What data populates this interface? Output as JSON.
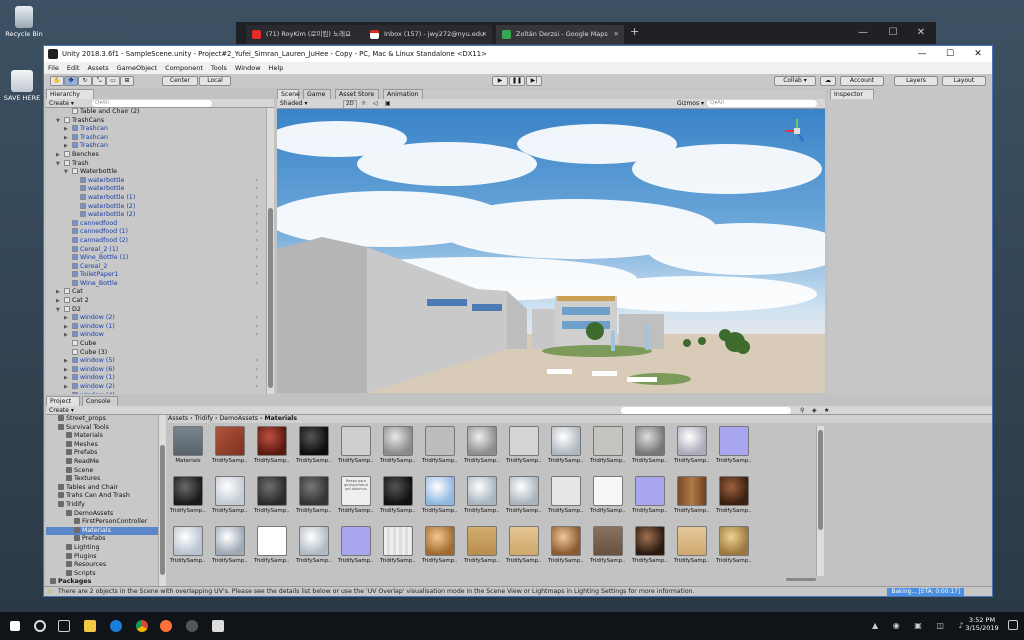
{
  "desktop": {
    "icons": [
      {
        "label": "Recycle Bin"
      },
      {
        "label": "SAVE HERE"
      }
    ]
  },
  "browser": {
    "tabs": [
      {
        "label": "(71) RoyKim (로이킴) 노래요"
      },
      {
        "label": "Inbox (157) - jwy272@nyu.edu"
      },
      {
        "label": "Zoltán Derzsi - Google Maps"
      }
    ],
    "new_tab": "+",
    "minimize": "—",
    "maximize": "☐",
    "close": "✕"
  },
  "window": {
    "title": "Unity 2018.3.6f1 - SampleScene.unity - Project#2_Yufei_Simran_Lauren_JuHee - Copy - PC, Mac & Linux Standalone <DX11>",
    "minimize": "—",
    "maximize": "☐",
    "close": "✕"
  },
  "menu": [
    "File",
    "Edit",
    "Assets",
    "GameObject",
    "Component",
    "Tools",
    "Window",
    "Help"
  ],
  "toolbar": {
    "center": "Center",
    "local": "Local",
    "collab": "Collab ▾",
    "account": "Account",
    "layers": "Layers",
    "layout": "Layout"
  },
  "hierarchy": {
    "tab": "Hierarchy",
    "create": "Create ▾",
    "search": "Q▾All",
    "rows": [
      {
        "label": "Table and Chair (2)",
        "indent": 1,
        "arrow": "",
        "blue": false
      },
      {
        "label": "TrashCans",
        "indent": 0,
        "arrow": "▼",
        "blue": false
      },
      {
        "label": "Trashcan",
        "indent": 1,
        "arrow": "▶",
        "blue": true
      },
      {
        "label": "Trashcan",
        "indent": 1,
        "arrow": "▶",
        "blue": true
      },
      {
        "label": "Trashcan",
        "indent": 1,
        "arrow": "▶",
        "blue": true
      },
      {
        "label": "Benches",
        "indent": 0,
        "arrow": "▶",
        "blue": false
      },
      {
        "label": "Trash",
        "indent": 0,
        "arrow": "▼",
        "blue": false
      },
      {
        "label": "Waterbottle",
        "indent": 1,
        "arrow": "▼",
        "blue": false
      },
      {
        "label": "waterbottle",
        "indent": 2,
        "arrow": "",
        "blue": true,
        "more": true
      },
      {
        "label": "waterbottle",
        "indent": 2,
        "arrow": "",
        "blue": true,
        "more": true
      },
      {
        "label": "waterbottle (1)",
        "indent": 2,
        "arrow": "",
        "blue": true,
        "more": true
      },
      {
        "label": "waterbottle (2)",
        "indent": 2,
        "arrow": "",
        "blue": true,
        "more": true
      },
      {
        "label": "waterbottle (2)",
        "indent": 2,
        "arrow": "",
        "blue": true,
        "more": true
      },
      {
        "label": "cannedfood",
        "indent": 1,
        "arrow": "",
        "blue": true,
        "more": true
      },
      {
        "label": "cannedfood (1)",
        "indent": 1,
        "arrow": "",
        "blue": true,
        "more": true
      },
      {
        "label": "cannedfood (2)",
        "indent": 1,
        "arrow": "",
        "blue": true,
        "more": true
      },
      {
        "label": "Cereal_2 (1)",
        "indent": 1,
        "arrow": "",
        "blue": true,
        "more": true
      },
      {
        "label": "Wine_Bottle (1)",
        "indent": 1,
        "arrow": "",
        "blue": true,
        "more": true
      },
      {
        "label": "Cereal_2",
        "indent": 1,
        "arrow": "",
        "blue": true,
        "more": true
      },
      {
        "label": "ToiletPaper1",
        "indent": 1,
        "arrow": "",
        "blue": true,
        "more": true
      },
      {
        "label": "Wine_Bottle",
        "indent": 1,
        "arrow": "",
        "blue": true,
        "more": true
      },
      {
        "label": "Cat",
        "indent": 0,
        "arrow": "▶",
        "blue": false
      },
      {
        "label": "Cat 2",
        "indent": 0,
        "arrow": "▶",
        "blue": false
      },
      {
        "label": "D2",
        "indent": 0,
        "arrow": "▼",
        "blue": false
      },
      {
        "label": "window (2)",
        "indent": 1,
        "arrow": "▶",
        "blue": true,
        "more": true
      },
      {
        "label": "window (1)",
        "indent": 1,
        "arrow": "▶",
        "blue": true,
        "more": true
      },
      {
        "label": "window",
        "indent": 1,
        "arrow": "▶",
        "blue": true,
        "more": true
      },
      {
        "label": "Cube",
        "indent": 1,
        "arrow": "",
        "blue": false
      },
      {
        "label": "Cube (3)",
        "indent": 1,
        "arrow": "",
        "blue": false
      },
      {
        "label": "window (5)",
        "indent": 1,
        "arrow": "▶",
        "blue": true,
        "more": true
      },
      {
        "label": "window (6)",
        "indent": 1,
        "arrow": "▶",
        "blue": true,
        "more": true
      },
      {
        "label": "window (1)",
        "indent": 1,
        "arrow": "▶",
        "blue": true,
        "more": true
      },
      {
        "label": "window (2)",
        "indent": 1,
        "arrow": "▶",
        "blue": true,
        "more": true
      },
      {
        "label": "window (4)",
        "indent": 1,
        "arrow": "▶",
        "blue": true,
        "more": true
      }
    ]
  },
  "scene": {
    "tabs": [
      "Scene",
      "Game",
      "Asset Store",
      "Animation"
    ],
    "shaded": "Shaded ▾",
    "mode2d": "2D",
    "gizmos": "Gizmos ▾",
    "search": "Q▾All"
  },
  "inspector": {
    "tab": "Inspector"
  },
  "project": {
    "tabs": [
      "Project",
      "Console"
    ],
    "create": "Create ▾",
    "folders": [
      {
        "label": "Street_props",
        "indent": 1
      },
      {
        "label": "Survival Tools",
        "indent": 1
      },
      {
        "label": "Materials",
        "indent": 2
      },
      {
        "label": "Meshes",
        "indent": 2
      },
      {
        "label": "Prefabs",
        "indent": 2
      },
      {
        "label": "ReadMe",
        "indent": 2
      },
      {
        "label": "Scene",
        "indent": 2
      },
      {
        "label": "Textures",
        "indent": 2
      },
      {
        "label": "Tables and Chair",
        "indent": 1
      },
      {
        "label": "Trahs Can And Trash",
        "indent": 1
      },
      {
        "label": "Tridify",
        "indent": 1
      },
      {
        "label": "DemoAssets",
        "indent": 2
      },
      {
        "label": "FirstPersonController",
        "indent": 3
      },
      {
        "label": "Materials",
        "indent": 3
      },
      {
        "label": "Prefabs",
        "indent": 3
      },
      {
        "label": "Lighting",
        "indent": 2
      },
      {
        "label": "Plugins",
        "indent": 2
      },
      {
        "label": "Resources",
        "indent": 2
      },
      {
        "label": "Scripts",
        "indent": 2
      },
      {
        "label": "Packages",
        "indent": 0
      }
    ],
    "breadcrumb": [
      "Assets",
      "Tridify",
      "DemoAssets",
      "Materials"
    ],
    "assets_row1": [
      "Materials",
      "TridifySamp...",
      "TridifySamp...",
      "TridifySamp...",
      "TridifySamp...",
      "TridifySamp...",
      "TridifySamp...",
      "TridifySamp...",
      "TridifySamp...",
      "TridifySamp...",
      "TridifySamp...",
      "TridifySamp...",
      "TridifySamp...",
      "TridifySamp..."
    ],
    "assets_row2": [
      "TridifySamp...",
      "TridifySamp...",
      "TridifySamp...",
      "TridifySamp...",
      "TridifySamp...",
      "TridifySamp...",
      "TridifySamp...",
      "TridifySamp...",
      "TridifySamp...",
      "TridifySamp...",
      "TridifySamp...",
      "TridifySamp...",
      "TridifySamp...",
      "TridifySamp..."
    ],
    "assets_row3": [
      "TridifySamp...",
      "TridifySamp...",
      "TridifySamp...",
      "TridifySamp...",
      "TridifySamp...",
      "TridifySamp...",
      "TridifySamp...",
      "TridifySamp...",
      "TridifySamp...",
      "TridifySamp...",
      "TridifySamp...",
      "TridifySamp...",
      "TridifySamp...",
      "TridifySamp..."
    ],
    "doc_text": "Reapo para ginjapurtatud gol dolomus"
  },
  "status": {
    "message": "There are 2 objects in the Scene with overlapping UV's. Please see the details list below or use the 'UV Overlap' visualisation mode in the Scene View or Lightmaps in Lighting Settings for more information.",
    "baking": "Baking... [ETA: 0:00:17]"
  },
  "taskbar": {
    "time": "3:52 PM",
    "date": "3/15/2019"
  }
}
